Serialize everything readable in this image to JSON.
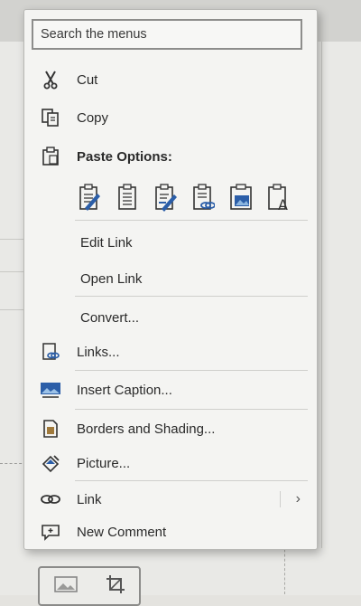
{
  "search": {
    "placeholder": "Search the menus"
  },
  "menu": {
    "cut": "Cut",
    "copy": "Copy",
    "paste_options": "Paste Options:",
    "edit_link": "Edit Link",
    "open_link": "Open Link",
    "convert": "Convert...",
    "links": "Links...",
    "insert_caption": "Insert Caption...",
    "borders_shading": "Borders and Shading...",
    "picture": "Picture...",
    "link": "Link",
    "new_comment": "New Comment"
  },
  "icons": {
    "cut": "scissors-icon",
    "copy": "copy-icon",
    "paste": "clipboard-icon",
    "links": "links-icon",
    "insert_caption": "caption-icon",
    "borders_shading": "borders-shading-icon",
    "picture": "picture-format-icon",
    "link": "link-icon",
    "new_comment": "comment-icon"
  },
  "colors": {
    "accent_blue": "#2b5ea8",
    "menu_bg": "#f4f4f2"
  }
}
